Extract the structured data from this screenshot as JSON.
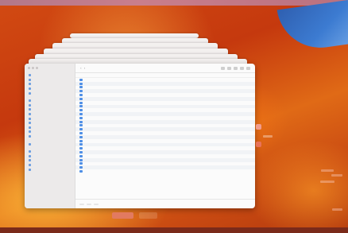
{
  "colors": {
    "folder": "#4f8fe6",
    "accent": "#e27a60",
    "wallpaper_orange": "#d24a12",
    "wallpaper_blue": "#3c7bd1"
  },
  "window": {
    "title": "",
    "toolbar_icons": [
      "chevron-left-icon",
      "chevron-right-icon",
      "view-icon",
      "share-icon",
      "tag-icon",
      "more-icon",
      "search-icon"
    ]
  },
  "sidebar": {
    "sections": [
      {
        "heading": "",
        "items": [
          "",
          "",
          "",
          "",
          ""
        ]
      },
      {
        "heading": "",
        "items": [
          "",
          "",
          "",
          "",
          "",
          "",
          "",
          "",
          ""
        ]
      },
      {
        "heading": "",
        "items": [
          ""
        ]
      },
      {
        "heading": "",
        "items": [
          "",
          "",
          "",
          "",
          ""
        ]
      }
    ]
  },
  "file_list": {
    "columns": {
      "name": "",
      "date": "",
      "size": ""
    },
    "rows": [
      {
        "name": "",
        "date": "",
        "size": ""
      },
      {
        "name": "",
        "date": "",
        "size": ""
      },
      {
        "name": "",
        "date": "",
        "size": ""
      },
      {
        "name": "",
        "date": "",
        "size": ""
      },
      {
        "name": "",
        "date": "",
        "size": ""
      },
      {
        "name": "",
        "date": "",
        "size": ""
      },
      {
        "name": "",
        "date": "",
        "size": ""
      },
      {
        "name": "",
        "date": "",
        "size": ""
      },
      {
        "name": "",
        "date": "",
        "size": ""
      },
      {
        "name": "",
        "date": "",
        "size": ""
      },
      {
        "name": "",
        "date": "",
        "size": ""
      },
      {
        "name": "",
        "date": "",
        "size": ""
      },
      {
        "name": "",
        "date": "",
        "size": ""
      },
      {
        "name": "",
        "date": "",
        "size": ""
      },
      {
        "name": "",
        "date": "",
        "size": ""
      },
      {
        "name": "",
        "date": "",
        "size": ""
      },
      {
        "name": "",
        "date": "",
        "size": ""
      },
      {
        "name": "",
        "date": "",
        "size": ""
      },
      {
        "name": "",
        "date": "",
        "size": ""
      },
      {
        "name": "",
        "date": "",
        "size": ""
      },
      {
        "name": "",
        "date": "",
        "size": ""
      },
      {
        "name": "",
        "date": "",
        "size": ""
      },
      {
        "name": "",
        "date": "",
        "size": ""
      },
      {
        "name": "",
        "date": "",
        "size": ""
      },
      {
        "name": "",
        "date": "",
        "size": ""
      }
    ]
  },
  "footer": {
    "items": [
      "",
      "",
      ""
    ]
  },
  "dialog": {
    "primary_label": "",
    "secondary_label": ""
  }
}
